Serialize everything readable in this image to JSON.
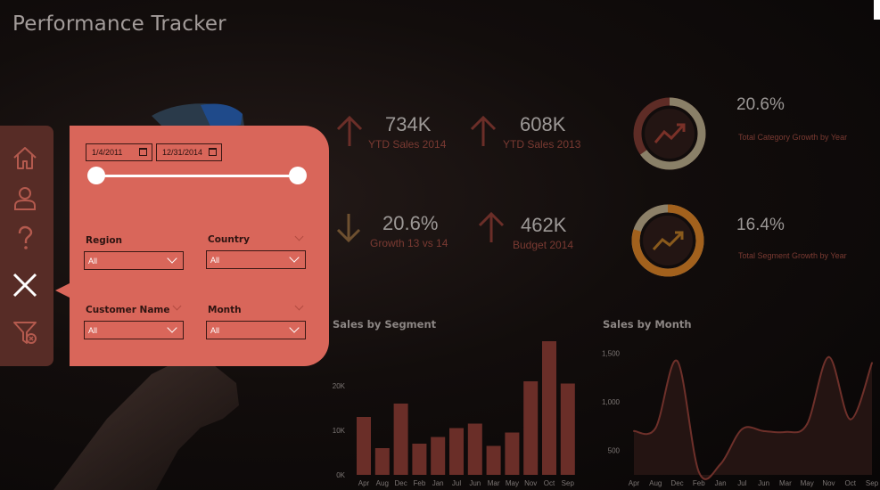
{
  "title": "Performance Tracker",
  "kpis": [
    {
      "value": "734K",
      "label": "YTD Sales 2014",
      "direction": "up"
    },
    {
      "value": "608K",
      "label": "YTD Sales 2013",
      "direction": "up"
    },
    {
      "value": "20.6%",
      "label": "Growth 13 vs 14",
      "direction": "down"
    },
    {
      "value": "462K",
      "label": "Budget 2014",
      "direction": "up"
    }
  ],
  "growth": [
    {
      "value": "20.6%",
      "label": "Total Category Growth by Year",
      "ring_color": "#5a2a24",
      "accent": "#c4b89a",
      "icon": "trend-up-icon",
      "fraction": 0.65
    },
    {
      "value": "16.4%",
      "label": "Total Segment Growth by Year",
      "ring_color": "#a06020",
      "accent": "#c4b89a",
      "icon": "trend-up-icon",
      "fraction": 0.8
    }
  ],
  "nav": {
    "items": [
      {
        "icon": "home-icon"
      },
      {
        "icon": "user-icon"
      },
      {
        "icon": "help-icon"
      },
      {
        "icon": "close-icon"
      },
      {
        "icon": "clear-filter-icon"
      }
    ]
  },
  "filters": {
    "start_date": "1/4/2011",
    "end_date": "12/31/2014",
    "region": {
      "label": "Region",
      "value": "All"
    },
    "country": {
      "label": "Country",
      "value": "All"
    },
    "customer": {
      "label": "Customer Name",
      "value": "All"
    },
    "month": {
      "label": "Month",
      "value": "All"
    }
  },
  "colors": {
    "accent": "#d9665a",
    "nav_bg": "#572c26",
    "bar": "#6b2e28",
    "label_red": "#7a3a32"
  },
  "chart_data": [
    {
      "type": "bar",
      "title": "Sales by Segment",
      "categories": [
        "Apr",
        "Aug",
        "Dec",
        "Feb",
        "Jan",
        "Jul",
        "Jun",
        "Mar",
        "May",
        "Nov",
        "Oct",
        "Sep"
      ],
      "values": [
        13000,
        6000,
        16000,
        7000,
        8500,
        10500,
        11500,
        6500,
        9500,
        21000,
        30000,
        20500
      ],
      "ylim": [
        0,
        30000
      ],
      "yticks": [
        "0K",
        "10K",
        "20K"
      ],
      "grid": false
    },
    {
      "type": "area",
      "title": "Sales by Month",
      "categories": [
        "Apr",
        "Aug",
        "Dec",
        "Feb",
        "Jan",
        "Jul",
        "Jun",
        "Mar",
        "May",
        "Nov",
        "Oct",
        "Sep"
      ],
      "values": [
        700,
        730,
        1420,
        280,
        360,
        720,
        700,
        690,
        770,
        1460,
        820,
        1400
      ],
      "ylim": [
        250,
        1650
      ],
      "yticks": [
        "500",
        "1,000",
        "1,500"
      ],
      "grid": false
    }
  ]
}
